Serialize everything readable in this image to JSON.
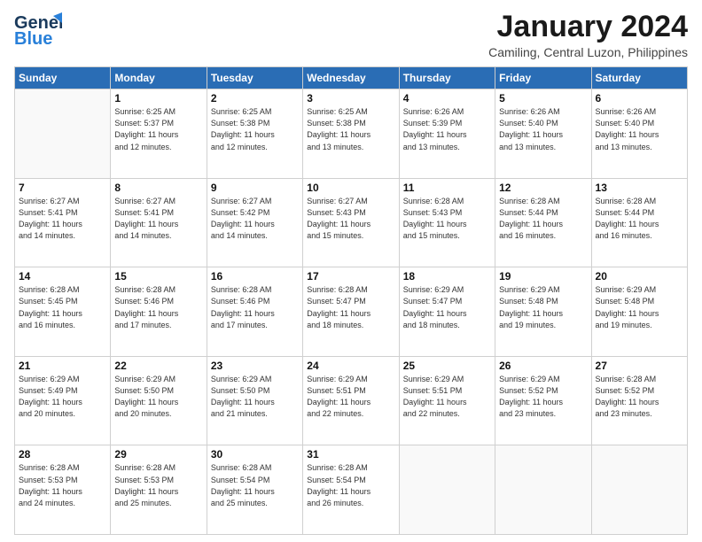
{
  "header": {
    "logo_line1": "General",
    "logo_line2": "Blue",
    "month_title": "January 2024",
    "location": "Camiling, Central Luzon, Philippines"
  },
  "weekdays": [
    "Sunday",
    "Monday",
    "Tuesday",
    "Wednesday",
    "Thursday",
    "Friday",
    "Saturday"
  ],
  "weeks": [
    [
      {
        "day": "",
        "detail": ""
      },
      {
        "day": "1",
        "detail": "Sunrise: 6:25 AM\nSunset: 5:37 PM\nDaylight: 11 hours\nand 12 minutes."
      },
      {
        "day": "2",
        "detail": "Sunrise: 6:25 AM\nSunset: 5:38 PM\nDaylight: 11 hours\nand 12 minutes."
      },
      {
        "day": "3",
        "detail": "Sunrise: 6:25 AM\nSunset: 5:38 PM\nDaylight: 11 hours\nand 13 minutes."
      },
      {
        "day": "4",
        "detail": "Sunrise: 6:26 AM\nSunset: 5:39 PM\nDaylight: 11 hours\nand 13 minutes."
      },
      {
        "day": "5",
        "detail": "Sunrise: 6:26 AM\nSunset: 5:40 PM\nDaylight: 11 hours\nand 13 minutes."
      },
      {
        "day": "6",
        "detail": "Sunrise: 6:26 AM\nSunset: 5:40 PM\nDaylight: 11 hours\nand 13 minutes."
      }
    ],
    [
      {
        "day": "7",
        "detail": "Sunrise: 6:27 AM\nSunset: 5:41 PM\nDaylight: 11 hours\nand 14 minutes."
      },
      {
        "day": "8",
        "detail": "Sunrise: 6:27 AM\nSunset: 5:41 PM\nDaylight: 11 hours\nand 14 minutes."
      },
      {
        "day": "9",
        "detail": "Sunrise: 6:27 AM\nSunset: 5:42 PM\nDaylight: 11 hours\nand 14 minutes."
      },
      {
        "day": "10",
        "detail": "Sunrise: 6:27 AM\nSunset: 5:43 PM\nDaylight: 11 hours\nand 15 minutes."
      },
      {
        "day": "11",
        "detail": "Sunrise: 6:28 AM\nSunset: 5:43 PM\nDaylight: 11 hours\nand 15 minutes."
      },
      {
        "day": "12",
        "detail": "Sunrise: 6:28 AM\nSunset: 5:44 PM\nDaylight: 11 hours\nand 16 minutes."
      },
      {
        "day": "13",
        "detail": "Sunrise: 6:28 AM\nSunset: 5:44 PM\nDaylight: 11 hours\nand 16 minutes."
      }
    ],
    [
      {
        "day": "14",
        "detail": "Sunrise: 6:28 AM\nSunset: 5:45 PM\nDaylight: 11 hours\nand 16 minutes."
      },
      {
        "day": "15",
        "detail": "Sunrise: 6:28 AM\nSunset: 5:46 PM\nDaylight: 11 hours\nand 17 minutes."
      },
      {
        "day": "16",
        "detail": "Sunrise: 6:28 AM\nSunset: 5:46 PM\nDaylight: 11 hours\nand 17 minutes."
      },
      {
        "day": "17",
        "detail": "Sunrise: 6:28 AM\nSunset: 5:47 PM\nDaylight: 11 hours\nand 18 minutes."
      },
      {
        "day": "18",
        "detail": "Sunrise: 6:29 AM\nSunset: 5:47 PM\nDaylight: 11 hours\nand 18 minutes."
      },
      {
        "day": "19",
        "detail": "Sunrise: 6:29 AM\nSunset: 5:48 PM\nDaylight: 11 hours\nand 19 minutes."
      },
      {
        "day": "20",
        "detail": "Sunrise: 6:29 AM\nSunset: 5:48 PM\nDaylight: 11 hours\nand 19 minutes."
      }
    ],
    [
      {
        "day": "21",
        "detail": "Sunrise: 6:29 AM\nSunset: 5:49 PM\nDaylight: 11 hours\nand 20 minutes."
      },
      {
        "day": "22",
        "detail": "Sunrise: 6:29 AM\nSunset: 5:50 PM\nDaylight: 11 hours\nand 20 minutes."
      },
      {
        "day": "23",
        "detail": "Sunrise: 6:29 AM\nSunset: 5:50 PM\nDaylight: 11 hours\nand 21 minutes."
      },
      {
        "day": "24",
        "detail": "Sunrise: 6:29 AM\nSunset: 5:51 PM\nDaylight: 11 hours\nand 22 minutes."
      },
      {
        "day": "25",
        "detail": "Sunrise: 6:29 AM\nSunset: 5:51 PM\nDaylight: 11 hours\nand 22 minutes."
      },
      {
        "day": "26",
        "detail": "Sunrise: 6:29 AM\nSunset: 5:52 PM\nDaylight: 11 hours\nand 23 minutes."
      },
      {
        "day": "27",
        "detail": "Sunrise: 6:28 AM\nSunset: 5:52 PM\nDaylight: 11 hours\nand 23 minutes."
      }
    ],
    [
      {
        "day": "28",
        "detail": "Sunrise: 6:28 AM\nSunset: 5:53 PM\nDaylight: 11 hours\nand 24 minutes."
      },
      {
        "day": "29",
        "detail": "Sunrise: 6:28 AM\nSunset: 5:53 PM\nDaylight: 11 hours\nand 25 minutes."
      },
      {
        "day": "30",
        "detail": "Sunrise: 6:28 AM\nSunset: 5:54 PM\nDaylight: 11 hours\nand 25 minutes."
      },
      {
        "day": "31",
        "detail": "Sunrise: 6:28 AM\nSunset: 5:54 PM\nDaylight: 11 hours\nand 26 minutes."
      },
      {
        "day": "",
        "detail": ""
      },
      {
        "day": "",
        "detail": ""
      },
      {
        "day": "",
        "detail": ""
      }
    ]
  ]
}
